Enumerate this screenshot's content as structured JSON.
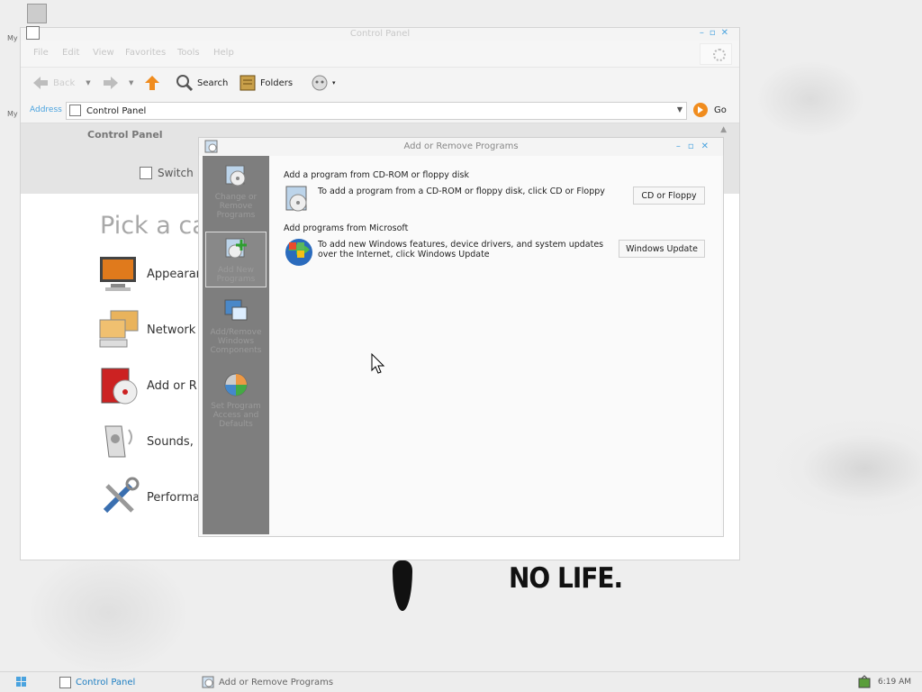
{
  "desktop": {
    "graffiti_text": "NO LIFE.",
    "icon_label_1": "My",
    "icon_label_2": "My"
  },
  "control_panel": {
    "title": "Control Panel",
    "menu": [
      "File",
      "Edit",
      "View",
      "Favorites",
      "Tools",
      "Help"
    ],
    "toolbar": {
      "back": "Back",
      "search": "Search",
      "folders": "Folders"
    },
    "address": {
      "label": "Address",
      "value": "Control Panel",
      "go": "Go"
    },
    "side_title": "Control Panel",
    "switch_label": "Switch",
    "heading": "Pick a ca",
    "categories": [
      "Appearar",
      "Network",
      "Add or R",
      "Sounds,",
      "Performa"
    ]
  },
  "add_remove": {
    "title": "Add or Remove Programs",
    "sidebar": [
      {
        "label": "Change or Remove Programs",
        "icon": "cd-box-icon"
      },
      {
        "label": "Add New Programs",
        "icon": "add-cd-icon"
      },
      {
        "label": "Add/Remove Windows Components",
        "icon": "windows-components-icon"
      },
      {
        "label": "Set Program Access and Defaults",
        "icon": "program-access-icon"
      }
    ],
    "sections": [
      {
        "heading": "Add a program from CD-ROM or floppy disk",
        "description": "To add a program from a CD-ROM or floppy disk, click CD or Floppy",
        "button": "CD or Floppy"
      },
      {
        "heading": "Add programs from Microsoft",
        "description": "To add new Windows features, device drivers, and system updates over the Internet, click Windows Update",
        "button": "Windows Update"
      }
    ]
  },
  "taskbar": {
    "tasks": [
      "Control Panel",
      "Add or Remove Programs"
    ],
    "clock": "6:19 AM"
  },
  "colors": {
    "accent": "#4aa3df",
    "sidebar": "#7e7e7e"
  }
}
